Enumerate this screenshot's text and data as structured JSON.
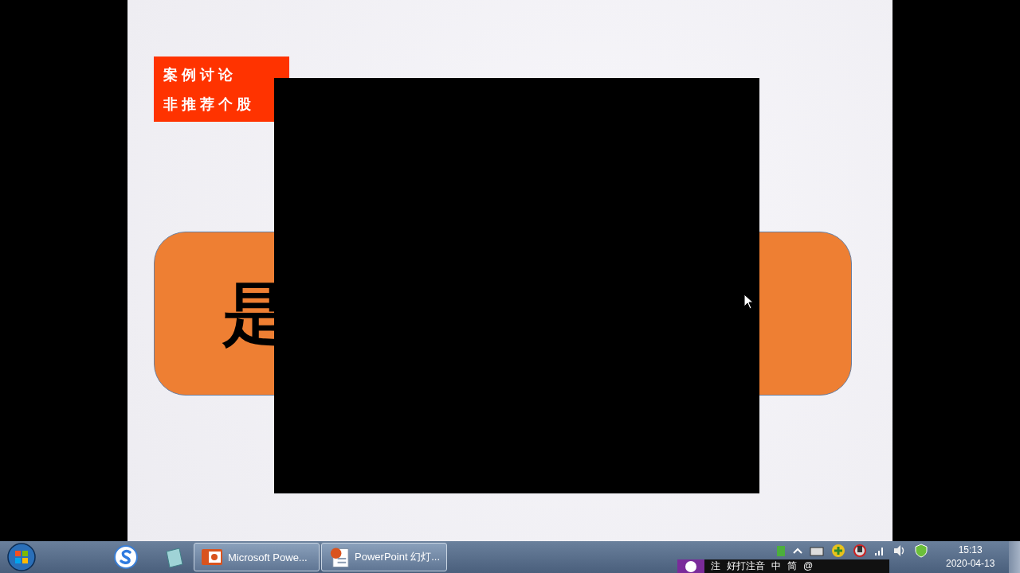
{
  "slide": {
    "tag_lines": [
      "案例讨论",
      "非推荐个股"
    ],
    "panel_text": "是"
  },
  "taskbar": {
    "pinned": [
      {
        "kind": "sogou"
      },
      {
        "kind": "notes"
      }
    ],
    "tasks": [
      {
        "kind": "ppt",
        "label": "Microsoft Powe..."
      },
      {
        "kind": "doc",
        "label": "PowerPoint 幻灯..."
      }
    ],
    "tray": {
      "time": "15:13",
      "date": "2020-04-13"
    }
  },
  "ime_bar": {
    "items": [
      "注",
      "好打注音",
      "中",
      "简",
      "@"
    ]
  }
}
